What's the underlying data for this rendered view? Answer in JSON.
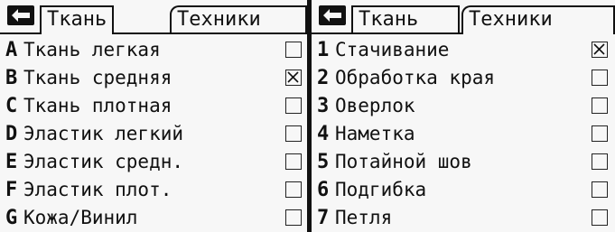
{
  "left": {
    "tabs": [
      "Ткань",
      "Техники"
    ],
    "active_tab": "Ткань",
    "items": [
      {
        "key": "A",
        "label": "Ткань легкая",
        "checked": false
      },
      {
        "key": "B",
        "label": "Ткань средняя",
        "checked": true
      },
      {
        "key": "C",
        "label": "Ткань плотная",
        "checked": false
      },
      {
        "key": "D",
        "label": "Эластик легкий",
        "checked": false
      },
      {
        "key": "E",
        "label": "Эластик средн.",
        "checked": false
      },
      {
        "key": "F",
        "label": "Эластик плот.",
        "checked": false
      },
      {
        "key": "G",
        "label": "Кожа/Винил",
        "checked": false
      }
    ]
  },
  "right": {
    "tabs": [
      "Ткань",
      "Техники"
    ],
    "active_tab": "Техники",
    "items": [
      {
        "key": "1",
        "label": "Стачивание",
        "checked": true
      },
      {
        "key": "2",
        "label": "Обработка края",
        "checked": false
      },
      {
        "key": "3",
        "label": "Оверлок",
        "checked": false
      },
      {
        "key": "4",
        "label": "Наметка",
        "checked": false
      },
      {
        "key": "5",
        "label": "Потайной шов",
        "checked": false
      },
      {
        "key": "6",
        "label": "Подгибка",
        "checked": false
      },
      {
        "key": "7",
        "label": "Петля",
        "checked": false
      }
    ]
  },
  "icons": {
    "back": "back-arrow-icon",
    "checkbox_checked": "x-mark-icon"
  }
}
